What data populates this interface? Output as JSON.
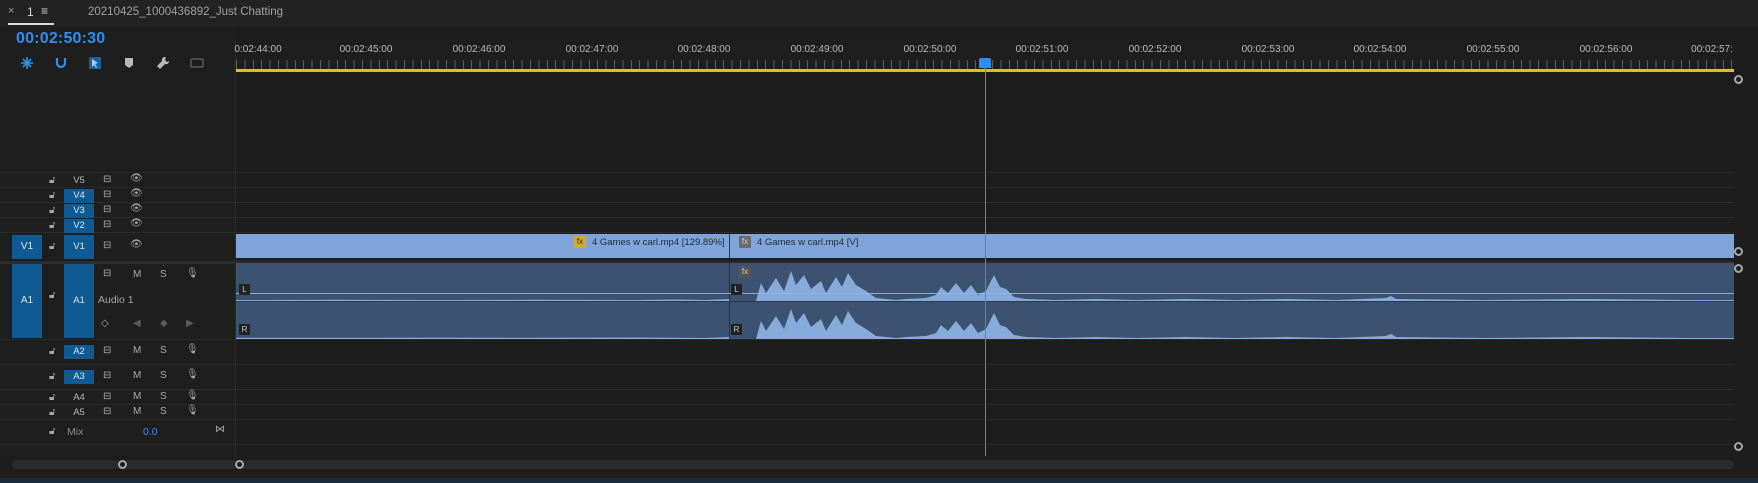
{
  "tab": {
    "close": "×",
    "label": "1",
    "menu": "≡"
  },
  "sequence_title": "20210425_1000436892_Just Chatting",
  "timecode": "00:02:50:30",
  "tools": [
    "snap-icon",
    "linked-selection-icon",
    "selection-icon",
    "marker-icon",
    "wrench-icon",
    "captions-icon"
  ],
  "ruler": {
    "labels": [
      "0:02:44:00",
      "00:02:45:00",
      "00:02:46:00",
      "00:02:47:00",
      "00:02:48:00",
      "00:02:49:00",
      "00:02:50:00",
      "00:02:51:00",
      "00:02:52:00",
      "00:02:53:00",
      "00:02:54:00",
      "00:02:55:00",
      "00:02:56:00",
      "00:02:57:"
    ]
  },
  "video_tracks": [
    {
      "id": "V5",
      "selected": false
    },
    {
      "id": "V4",
      "selected": true
    },
    {
      "id": "V3",
      "selected": true
    },
    {
      "id": "V2",
      "selected": true
    },
    {
      "id": "V1",
      "selected": true,
      "source": "V1"
    }
  ],
  "audio_tracks": [
    {
      "id": "A1",
      "source": "A1",
      "name": "Audio 1",
      "mute": "M",
      "solo": "S"
    },
    {
      "id": "A2",
      "mute": "M",
      "solo": "S"
    },
    {
      "id": "A3",
      "mute": "M",
      "solo": "S"
    },
    {
      "id": "A4",
      "mute": "M",
      "solo": "S"
    },
    {
      "id": "A5",
      "mute": "M",
      "solo": "S"
    }
  ],
  "mix": {
    "label": "Mix",
    "value": "0.0"
  },
  "clips": {
    "v1_a": {
      "name": "4 Games w carl.mp4 [129.89%]",
      "badge": "fx"
    },
    "v1_b": {
      "name": "4 Games w carl.mp4 [V]",
      "badge": "fx"
    },
    "a1_left": "L",
    "a1_right": "R"
  },
  "colors": {
    "accent": "#2f8ff0",
    "clip_video": "#7fa4d9",
    "clip_audio": "#3b5270",
    "work_area": "#d6c02c",
    "track_selected": "#0f5a93"
  }
}
